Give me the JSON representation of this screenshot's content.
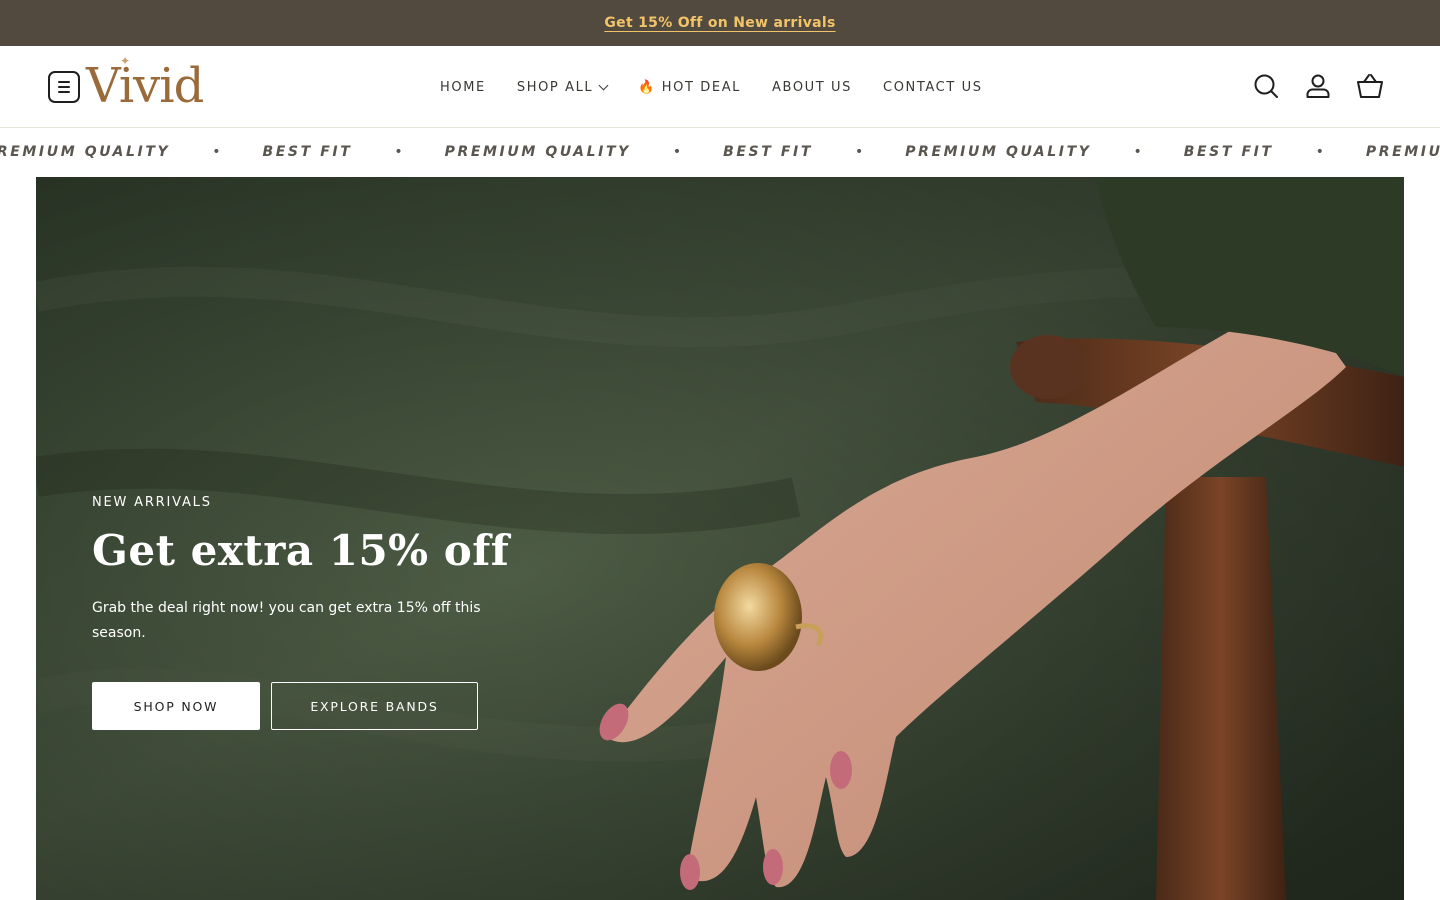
{
  "announcement": {
    "text": "Get 15% Off on New arrivals"
  },
  "brand": {
    "logo_text": "Vivid"
  },
  "nav": {
    "items": [
      {
        "label": "HOME"
      },
      {
        "label": "SHOP ALL"
      },
      {
        "label": "🔥 HOT DEAL"
      },
      {
        "label": "ABOUT US"
      },
      {
        "label": "CONTACT US"
      }
    ]
  },
  "header_icons": [
    "search-icon",
    "account-icon",
    "cart-icon"
  ],
  "marquee": {
    "items": [
      "PREMIUM QUALITY",
      "BEST FIT",
      "PREMIUM QUALITY",
      "BEST FIT",
      "PREMIUM QUALITY",
      "BEST FIT",
      "PREMIUM QUALITY"
    ],
    "separator": "•"
  },
  "hero": {
    "eyebrow": "NEW ARRIVALS",
    "headline": "Get extra 15% off",
    "subtext": "Grab the deal right now! you can get extra 15% off this season.",
    "primary_button": "SHOP NOW",
    "secondary_button": "EXPLORE BANDS"
  },
  "colors": {
    "announcement_bg": "#524a3f",
    "announcement_text": "#f2c46a",
    "logo": "#9b6a3a",
    "hero_green": "#3d4a37"
  }
}
